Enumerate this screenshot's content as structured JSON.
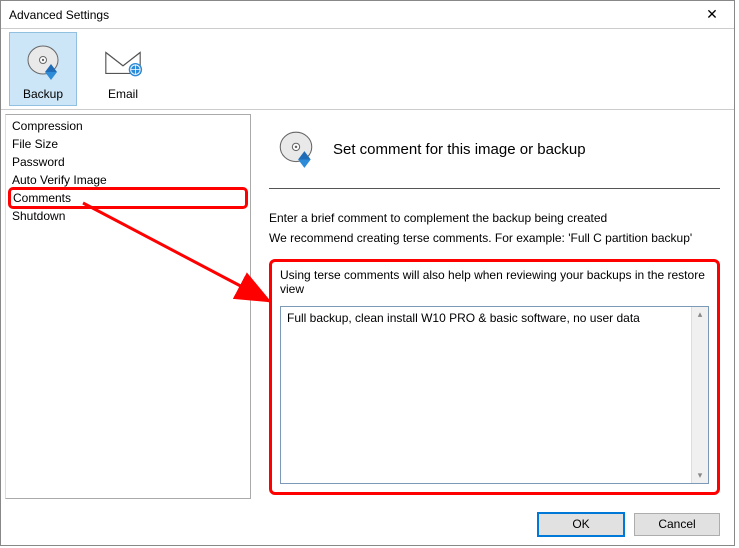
{
  "window": {
    "title": "Advanced Settings"
  },
  "toolbar": {
    "backup_label": "Backup",
    "email_label": "Email"
  },
  "sidebar": {
    "items": [
      {
        "label": "Compression"
      },
      {
        "label": "File Size"
      },
      {
        "label": "Password"
      },
      {
        "label": "Auto Verify Image"
      },
      {
        "label": "Comments"
      },
      {
        "label": "Shutdown"
      }
    ]
  },
  "main": {
    "heading": "Set comment for this image or backup",
    "desc1": "Enter a brief comment to complement the backup being created",
    "desc2": "We recommend creating terse comments. For example: 'Full C partition backup'",
    "hint": "Using terse comments will also help when reviewing your backups in the restore view",
    "textarea_value": "Full backup, clean install W10 PRO & basic software, no user data"
  },
  "footer": {
    "ok_label": "OK",
    "cancel_label": "Cancel"
  }
}
